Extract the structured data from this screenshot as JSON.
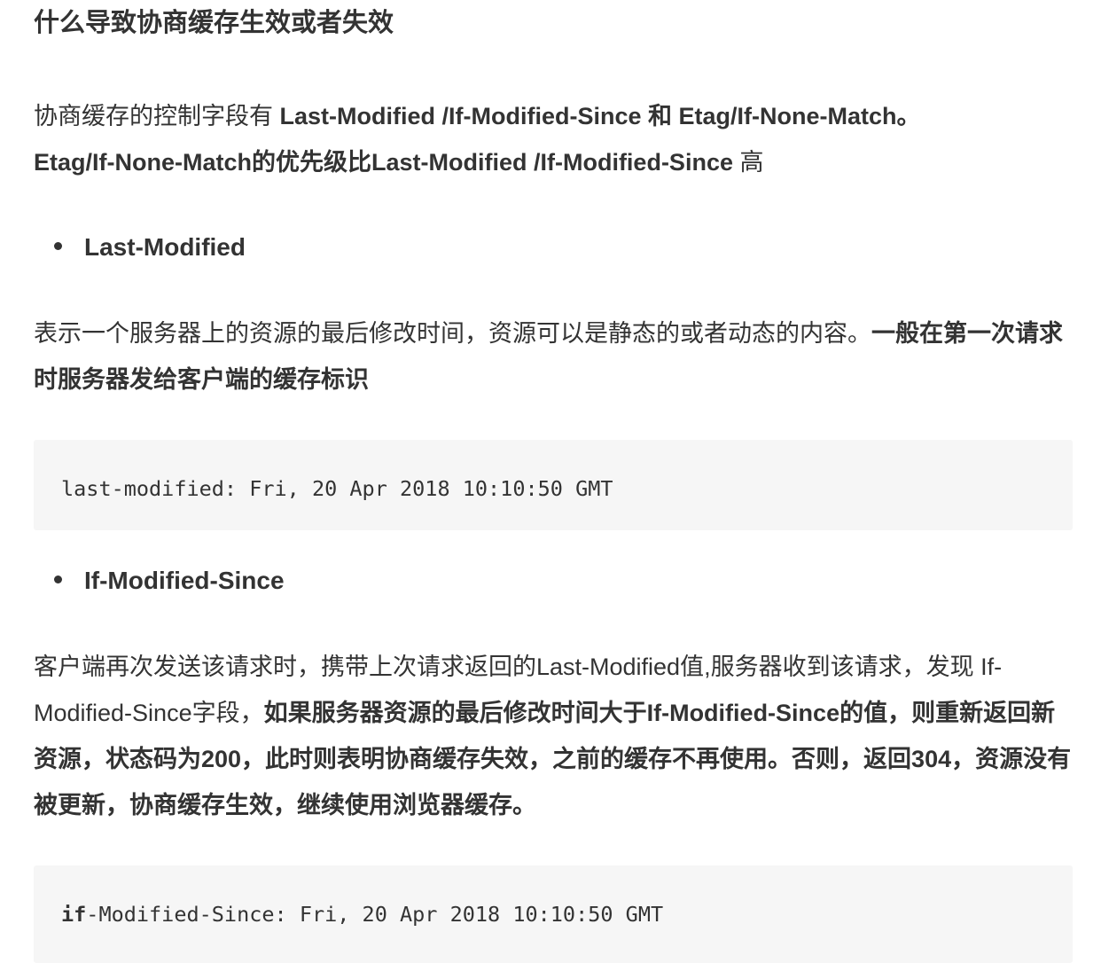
{
  "heading": "什么导致协商缓存生效或者失效",
  "intro": {
    "line1_prefix": "协商缓存的控制字段有 ",
    "line1_bold": "Last-Modified /If-Modified-Since 和 Etag/If-None-Match。",
    "line2_bold": "Etag/If-None-Match的优先级比Last-Modified /If-Modified-Since",
    "line2_suffix": " 高"
  },
  "section_last_modified": {
    "bullet": "Last-Modified",
    "desc_normal": "表示一个服务器上的资源的最后修改时间，资源可以是静态的或者动态的内容。",
    "desc_bold": "一般在第一次请求时服务器发给客户端的缓存标识",
    "code": "last-modified: Fri, 20 Apr 2018 10:10:50 GMT"
  },
  "section_if_modified_since": {
    "bullet": "If-Modified-Since",
    "desc_normal": "客户端再次发送该请求时，携带上次请求返回的Last-Modified值,服务器收到该请求，发现 If-Modified-Since字段，",
    "desc_bold": "如果服务器资源的最后修改时间大于If-Modified-Since的值，则重新返回新资源，状态码为200，此时则表明协商缓存失效，之前的缓存不再使用。否则，返回304，资源没有被更新，协商缓存生效，继续使用浏览器缓存。",
    "code_keyword": "if",
    "code_rest": "-Modified-Since: Fri, 20 Apr 2018 10:10:50 GMT"
  }
}
